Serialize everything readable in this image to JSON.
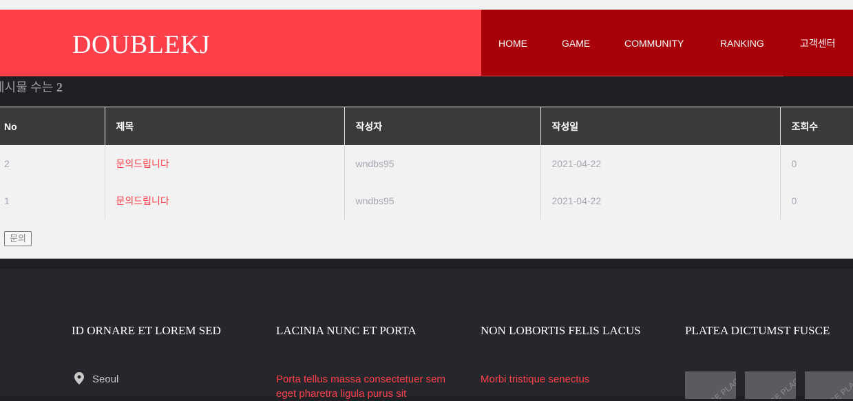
{
  "header": {
    "logo": "DOUBLEKJ"
  },
  "nav": {
    "items": [
      "HOME",
      "GAME",
      "COMMUNITY",
      "RANKING",
      "고객센터"
    ]
  },
  "board": {
    "count_label": "게시물 수는",
    "count_value": "2",
    "columns": [
      "No",
      "제목",
      "작성자",
      "작성일",
      "조회수"
    ],
    "rows": [
      {
        "no": "2",
        "title": "문의드립니다",
        "author": "wndbs95",
        "date": "2021-04-22",
        "views": "0"
      },
      {
        "no": "1",
        "title": "문의드립니다",
        "author": "wndbs95",
        "date": "2021-04-22",
        "views": "0"
      }
    ],
    "button_label": "문의"
  },
  "footer": {
    "headings": [
      "ID ORNARE ET LOREM SED",
      "LACINIA NUNC ET PORTA",
      "NON LOBORTIS FELIS LACUS",
      "PLATEA DICTUMST FUSCE"
    ],
    "location": "Seoul",
    "col2_link": "Porta tellus massa consectetuer sem eget pharetra ligula purus sit",
    "col3_link": "Morbi tristique senectus",
    "thumb_text": "IMAGE PLACEHOLDER"
  }
}
